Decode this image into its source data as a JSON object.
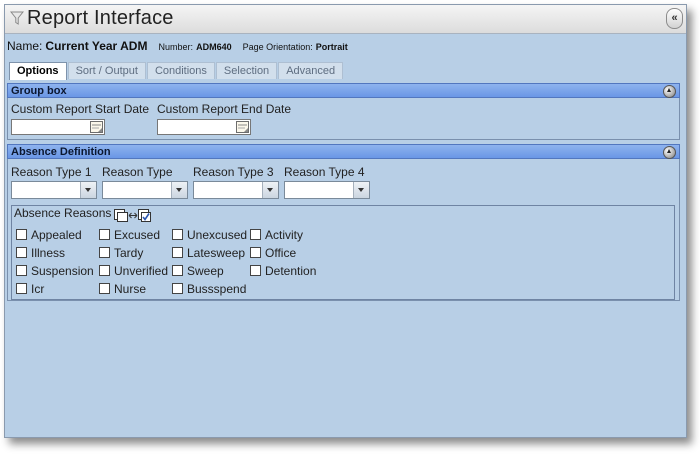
{
  "window": {
    "title": "Report Interface",
    "collapse_label": "«"
  },
  "info": {
    "name_label": "Name:",
    "name_value": "Current Year ADM",
    "number_label": "Number:",
    "number_value": "ADM640",
    "orientation_label": "Page Orientation:",
    "orientation_value": "Portrait"
  },
  "tabs": [
    {
      "label": "Options",
      "active": true
    },
    {
      "label": "Sort / Output",
      "active": false
    },
    {
      "label": "Conditions",
      "active": false
    },
    {
      "label": "Selection",
      "active": false
    },
    {
      "label": "Advanced",
      "active": false
    }
  ],
  "group_box": {
    "header": "Group box",
    "start_date_label": "Custom Report Start Date",
    "start_date_value": "",
    "end_date_label": "Custom Report End Date",
    "end_date_value": ""
  },
  "absence": {
    "header": "Absence Definition",
    "reason_types": [
      {
        "label": "Reason Type 1",
        "value": ""
      },
      {
        "label": "Reason Type",
        "value": ""
      },
      {
        "label": "Reason Type 3",
        "value": ""
      },
      {
        "label": "Reason Type 4",
        "value": ""
      }
    ],
    "reasons_legend": "Absence Reasons",
    "reasons": [
      {
        "label": "Appealed",
        "checked": false
      },
      {
        "label": "Excused",
        "checked": false
      },
      {
        "label": "Unexcused",
        "checked": false
      },
      {
        "label": "Activity",
        "checked": false
      },
      {
        "label": "Illness",
        "checked": false
      },
      {
        "label": "Tardy",
        "checked": false
      },
      {
        "label": "Latesweep",
        "checked": false
      },
      {
        "label": "Office",
        "checked": false
      },
      {
        "label": "Suspension",
        "checked": false
      },
      {
        "label": "Unverified",
        "checked": false
      },
      {
        "label": "Sweep",
        "checked": false
      },
      {
        "label": "Detention",
        "checked": false
      },
      {
        "label": "Icr",
        "checked": false
      },
      {
        "label": "Nurse",
        "checked": false
      },
      {
        "label": "Bussspend",
        "checked": false
      }
    ]
  },
  "colors": {
    "panel_bg": "#b8cfe6",
    "section_header": "#7aa3ea"
  },
  "icons": {
    "title": "filter-funnel-icon",
    "date_picker": "calendar-icon",
    "toggle_all": "toggle-all-checkboxes-icon",
    "section_collapse": "collapse-circle-icon"
  }
}
